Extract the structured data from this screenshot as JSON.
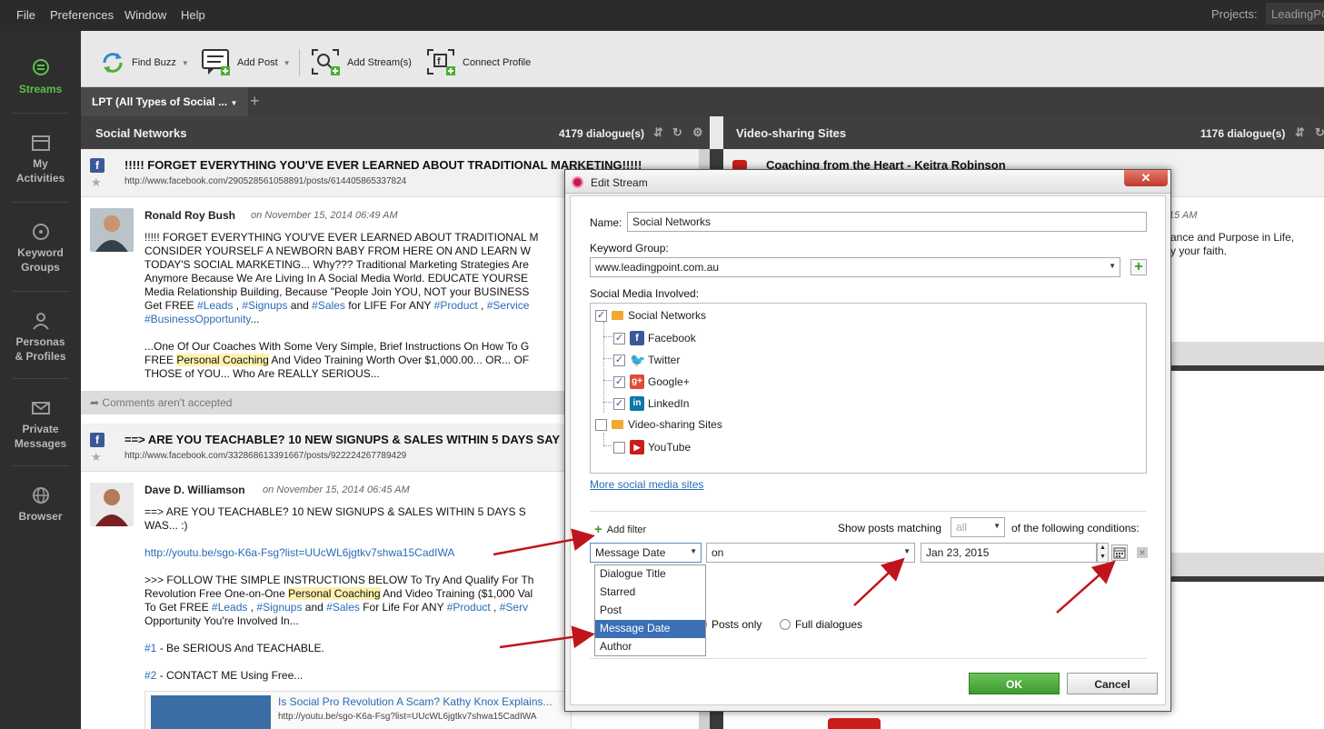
{
  "menu": {
    "file": "File",
    "preferences": "Preferences",
    "window": "Window",
    "help": "Help",
    "projects_label": "Projects:",
    "project_value": "LeadingPC"
  },
  "sidebar": [
    {
      "label1": "Streams",
      "label2": ""
    },
    {
      "label1": "My",
      "label2": "Activities"
    },
    {
      "label1": "Keyword",
      "label2": "Groups"
    },
    {
      "label1": "Personas",
      "label2": "& Profiles"
    },
    {
      "label1": "Private",
      "label2": "Messages"
    },
    {
      "label1": "Browser",
      "label2": ""
    }
  ],
  "toolbar": {
    "find_buzz": "Find Buzz",
    "add_post": "Add Post",
    "add_streams": "Add Stream(s)",
    "connect_profile": "Connect Profile"
  },
  "tab": {
    "label": "LPT (All Types of Social ...",
    "plus": "+"
  },
  "col1": {
    "title": "Social Networks",
    "count": "4179 dialogue(s)",
    "post1": {
      "title": "!!!!! FORGET EVERYTHING YOU'VE EVER LEARNED ABOUT TRADITIONAL MARKETING!!!!!",
      "link": "http://www.facebook.com/290528561058891/posts/614405865337824",
      "author": "Ronald Roy Bush",
      "date": "on November 15, 2014 06:49 AM",
      "l1": "!!!!! FORGET EVERYTHING YOU'VE EVER LEARNED ABOUT TRADITIONAL M",
      "l2": "CONSIDER YOURSELF A NEWBORN BABY FROM HERE ON AND LEARN W",
      "l3": "TODAY'S SOCIAL MARKETING... Why??? Traditional Marketing Strategies Are",
      "l4": "Anymore Because We Are Living In A Social Media World. EDUCATE YOURSE",
      "l5": "Media Relationship Building, Because \"People Join YOU, NOT your BUSINESS",
      "l6a": "Get FREE ",
      "l6b": "#Leads",
      "l6c": " , ",
      "l6d": "#Signups",
      "l6e": " and ",
      "l6f": "#Sales",
      "l6g": " for LIFE For ANY ",
      "l6h": "#Product",
      "l6i": " , ",
      "l6j": "#Service",
      "l7a": "#BusinessOpportunity",
      "l7b": "...",
      "l8": "...One Of Our Coaches With Some Very Simple, Brief Instructions On How To G",
      "l9a": "FREE ",
      "l9b": "Personal Coaching",
      "l9c": " And Video Training Worth Over $1,000.00... OR... OF",
      "l10": "THOSE of YOU... Who Are REALLY SERIOUS...",
      "comments": "Comments aren't accepted"
    },
    "post2": {
      "title": "==> ARE YOU TEACHABLE? 10 NEW SIGNUPS & SALES WITHIN 5 DAYS SAY",
      "link": "http://www.facebook.com/332868613391667/posts/922224267789429",
      "author": "Dave D. Williamson",
      "date": "on November 15, 2014 06:45 AM",
      "l1": "==> ARE YOU TEACHABLE? 10 NEW SIGNUPS & SALES WITHIN 5 DAYS S",
      "l2": "WAS... :)",
      "l3": "http://youtu.be/sgo-K6a-Fsg?list=UUcWL6jgtkv7shwa15CadIWA",
      "l4": ">>> FOLLOW THE SIMPLE INSTRUCTIONS BELOW To Try And Qualify For Th",
      "l5a": "Revolution Free One-on-One ",
      "l5b": "Personal Coaching",
      "l5c": " And Video Training ($1,000 Val",
      "l6a": "To Get FREE ",
      "l6b": "#Leads",
      "l6c": " , ",
      "l6d": "#Signups",
      "l6e": " and ",
      "l6f": "#Sales",
      "l6g": " For Life For ANY ",
      "l6h": "#Product",
      "l6i": " , ",
      "l6j": "#Serv",
      "l7": "Opportunity You're Involved In...",
      "l8a": "#1",
      "l8b": " - Be SERIOUS And TEACHABLE.",
      "l9a": "#2",
      "l9b": " - CONTACT ME Using Free...",
      "embed_title": "Is Social Pro Revolution A Scam? Kathy Knox Explains...",
      "embed_link": "http://youtu.be/sgo-K6a-Fsg?list=UUcWL6jgtkv7shwa15CadIWA"
    }
  },
  "col2": {
    "title": "Video-sharing Sites",
    "count": "1176 dialogue(s)",
    "post1_title": "Coaching from the Heart - Keitra Robinson",
    "date_frag": "15 AM",
    "text1": "ance and Purpose in Life,",
    "text2": "y your faith."
  },
  "dialog": {
    "title": "Edit Stream",
    "close": "✕",
    "name_label": "Name:",
    "name_value": "Social Networks",
    "kg_label": "Keyword Group:",
    "kg_value": "www.leadingpoint.com.au",
    "smi_label": "Social Media Involved:",
    "tree": {
      "social_networks": "Social Networks",
      "facebook": "Facebook",
      "twitter": "Twitter",
      "googleplus": "Google+",
      "linkedin": "LinkedIn",
      "video_sites": "Video-sharing Sites",
      "youtube": "YouTube"
    },
    "more_sites": "More social media sites",
    "add_filter": "Add filter",
    "show_posts": "Show posts matching",
    "match_value": "all",
    "of_following": "of the following conditions:",
    "field_value": "Message Date",
    "op_value": "on",
    "date_value": "Jan 23, 2015",
    "dropdown": [
      "Dialogue Title",
      "Starred",
      "Post",
      "Message Date",
      "Author"
    ],
    "posts_only": "Posts only",
    "full_dialogues": "Full dialogues",
    "ok": "OK",
    "cancel": "Cancel"
  },
  "colors": {
    "accent_green": "#4caf2f",
    "link_blue": "#2a6bb8",
    "selection": "#3b6fb6",
    "annotation_arrow": "#c0141c"
  }
}
